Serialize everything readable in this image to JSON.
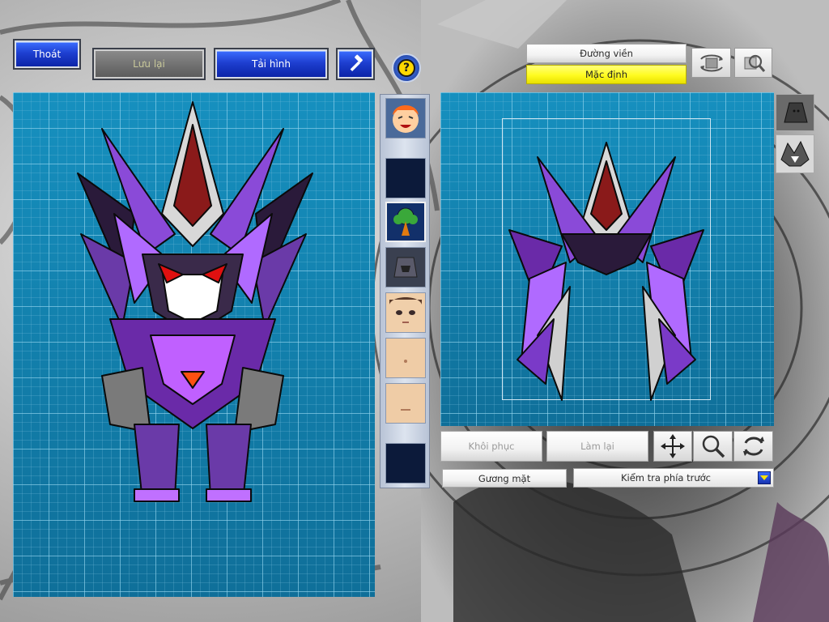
{
  "toolbar": {
    "exit_label": "Thoát",
    "save_label": "Lưu lại",
    "reload_label": "Tải hình"
  },
  "help": {
    "label": "?"
  },
  "right_top": {
    "outline_label": "Đường viền",
    "default_label": "Mặc định"
  },
  "right_tools": {
    "restore_label": "Khôi phục",
    "redo_label": "Làm lại"
  },
  "bottom": {
    "face_label": "Gương mặt",
    "preview_select_value": "Kiểm tra phía trước"
  },
  "colors": {
    "panel": "#137ba6",
    "button_blue": "#1e3fd0",
    "highlight_yellow": "#fffb1f"
  },
  "icons": [
    "hammer-icon",
    "help-icon",
    "rotate-view-icon",
    "magnify-view-icon",
    "move-icon",
    "zoom-icon",
    "rotate-icon",
    "dropdown-arrow-icon"
  ]
}
